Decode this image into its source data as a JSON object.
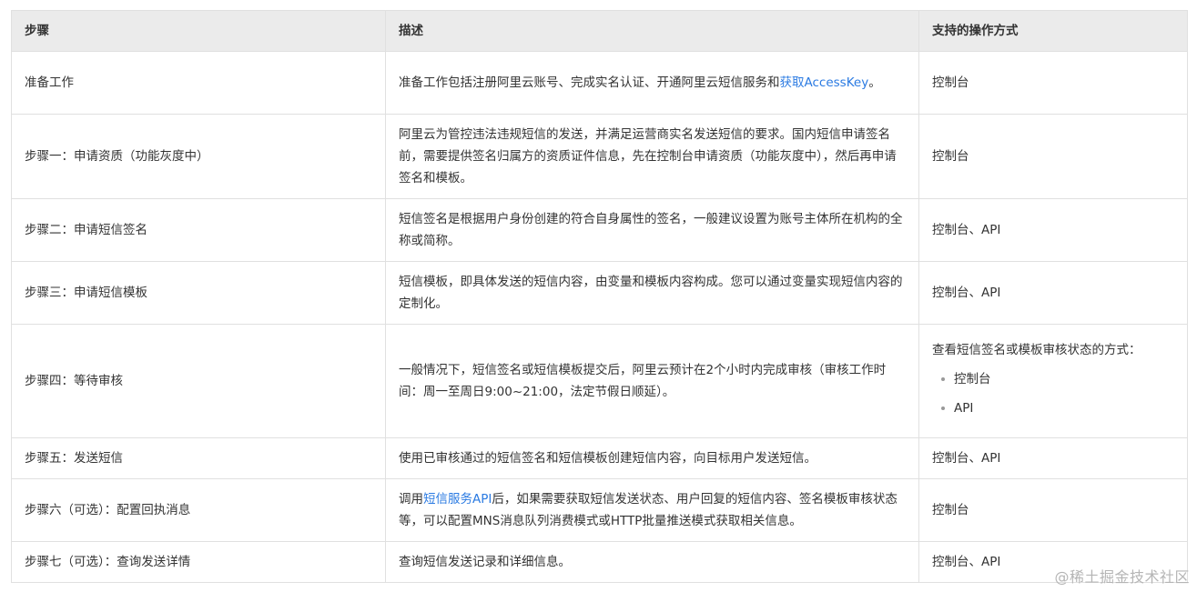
{
  "table": {
    "headers": [
      "步骤",
      "描述",
      "支持的操作方式"
    ],
    "rows": [
      {
        "step": "准备工作",
        "desc_before": "准备工作包括注册阿里云账号、完成实名认证、开通阿里云短信服务和",
        "desc_link": "获取AccessKey",
        "desc_after": "。",
        "ops": "控制台"
      },
      {
        "step": "步骤一：申请资质（功能灰度中）",
        "desc": "阿里云为管控违法违规短信的发送，并满足运营商实名发送短信的要求。国内短信申请签名前，需要提供签名归属方的资质证件信息，先在控制台申请资质（功能灰度中），然后再申请签名和模板。",
        "ops": "控制台"
      },
      {
        "step": "步骤二：申请短信签名",
        "desc": "短信签名是根据用户身份创建的符合自身属性的签名，一般建议设置为账号主体所在机构的全称或简称。",
        "ops": "控制台、API"
      },
      {
        "step": "步骤三：申请短信模板",
        "desc": "短信模板，即具体发送的短信内容，由变量和模板内容构成。您可以通过变量实现短信内容的定制化。",
        "ops": "控制台、API"
      },
      {
        "step": "步骤四：等待审核",
        "desc": "一般情况下，短信签名或短信模板提交后，阿里云预计在2个小时内完成审核（审核工作时间：周一至周日9:00~21:00，法定节假日顺延）。",
        "ops_intro": "查看短信签名或模板审核状态的方式：",
        "ops_items": [
          "控制台",
          "API"
        ]
      },
      {
        "step": "步骤五：发送短信",
        "desc": "使用已审核通过的短信签名和短信模板创建短信内容，向目标用户发送短信。",
        "ops": "控制台、API"
      },
      {
        "step": "步骤六（可选）：配置回执消息",
        "desc_before": "调用",
        "desc_link": "短信服务API",
        "desc_after": "后，如果需要获取短信发送状态、用户回复的短信内容、签名模板审核状态等，可以配置MNS消息队列消费模式或HTTP批量推送模式获取相关信息。",
        "ops": "控制台"
      },
      {
        "step": "步骤七（可选）：查询发送详情",
        "desc": "查询短信发送记录和详细信息。",
        "ops": "控制台、API"
      }
    ]
  },
  "watermark": "@稀土掘金技术社区",
  "colors": {
    "link": "#2a7ae2",
    "header_bg": "#ebebeb",
    "border": "#e0e0e0",
    "text": "#333333"
  }
}
